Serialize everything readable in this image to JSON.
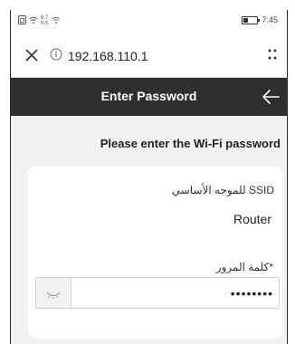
{
  "status_bar": {
    "left_icons": [
      "sim-icon",
      "wifi-icon",
      "network-speed-icon",
      "wifi-icon"
    ],
    "speed_top": "6.7",
    "speed_bottom": "K/s",
    "time": "7:45"
  },
  "browser": {
    "url": "192.168.110.1",
    "icons": [
      "close-icon",
      "info-icon",
      "menu-icon"
    ]
  },
  "header": {
    "title": "Enter Password",
    "back_icon": "back-arrow-icon"
  },
  "prompt": "Please enter the Wi-Fi password",
  "form": {
    "ssid_label": "SSID للموجه الأساسي",
    "ssid_value": "Router",
    "password_label": "*كلمة المرور",
    "password_value": "••••••••",
    "eye_icon": "eye-closed-icon"
  },
  "colors": {
    "header_bg": "#2f2f2f",
    "page_bg": "#f1f1f1",
    "card_bg": "#ffffff"
  }
}
